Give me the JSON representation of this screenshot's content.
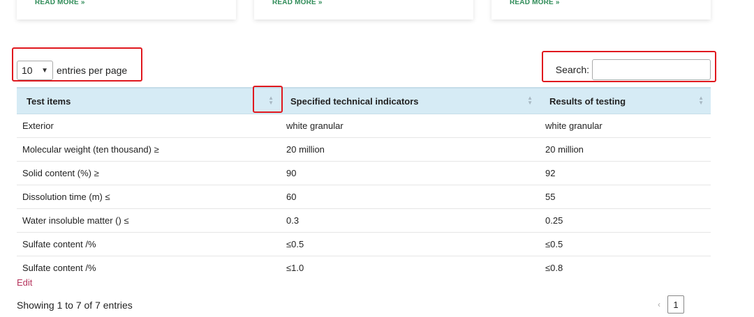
{
  "cards": [
    {
      "link": "READ MORE »"
    },
    {
      "link": "READ MORE »"
    },
    {
      "link": "READ MORE »"
    }
  ],
  "length_control": {
    "selected": "10",
    "suffix": "entries per page"
  },
  "search": {
    "label": "Search:",
    "value": ""
  },
  "table": {
    "headers": [
      "Test items",
      "Specified technical indicators",
      "Results of testing"
    ],
    "rows": [
      [
        "Exterior",
        "white granular",
        "white granular"
      ],
      [
        "Molecular weight (ten thousand) ≥",
        "20 million",
        "20 million"
      ],
      [
        "Solid content (%) ≥",
        "90",
        "92"
      ],
      [
        "Dissolution time (m) ≤",
        "60",
        "55"
      ],
      [
        "Water insoluble matter () ≤",
        "0.3",
        "0.25"
      ],
      [
        "Sulfate content /%",
        "≤0.5",
        "≤0.5"
      ],
      [
        "Sulfate content /%",
        "≤1.0",
        "≤0.8"
      ]
    ]
  },
  "edit_link": "Edit",
  "info": "Showing 1 to 7 of 7 entries",
  "pagination": {
    "prev": "‹",
    "current": "1"
  },
  "colors": {
    "header_bg": "#d6ebf5",
    "highlight": "#e0181e",
    "link_green": "#2e8b57",
    "edit_link": "#b5345c"
  }
}
